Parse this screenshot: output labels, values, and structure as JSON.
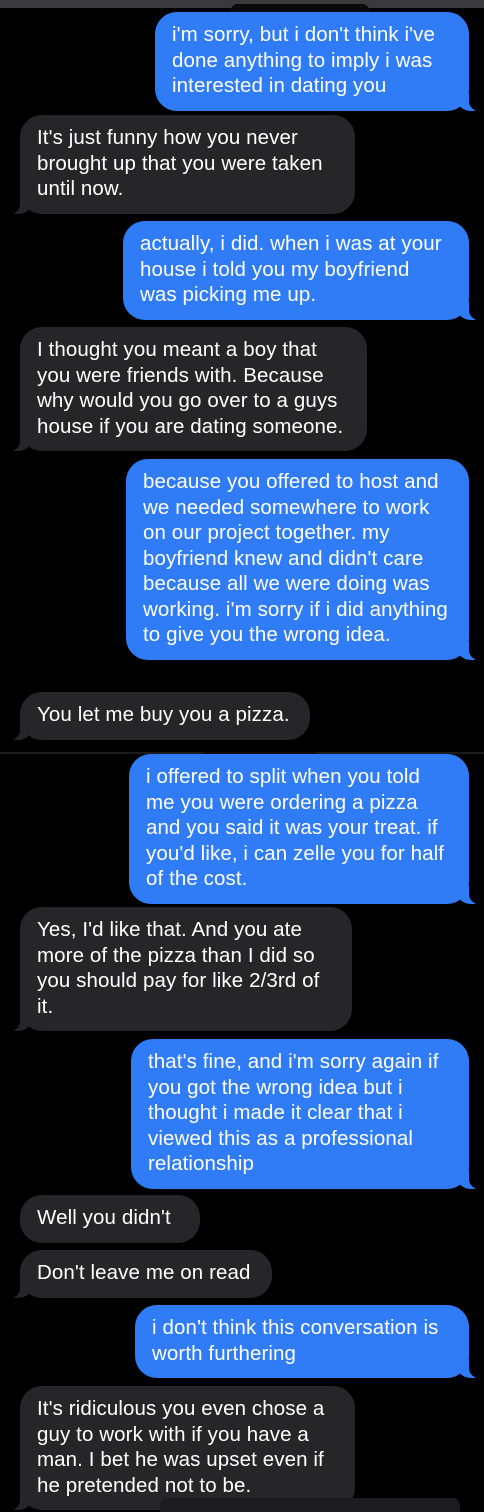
{
  "conversation": {
    "messages": [
      {
        "direction": "sent",
        "text": "i'm sorry, but i don't think i've done anything to imply i was interested in dating you"
      },
      {
        "direction": "received",
        "text": "It's just funny how you never brought up that you were taken until now."
      },
      {
        "direction": "sent",
        "text": "actually, i did. when i was at your house i told you my boyfriend was picking me up."
      },
      {
        "direction": "received",
        "text": "I thought you meant a boy that you were friends with. Because why would you go over to a guys house if you are dating someone."
      },
      {
        "direction": "sent",
        "text": "because you offered to host and we needed somewhere to work on our project together. my boyfriend knew and didn't care because all we were doing was working. i'm sorry if i did anything to give you the wrong idea."
      },
      {
        "direction": "received",
        "text": "You let me buy you a pizza."
      },
      {
        "direction": "sent",
        "text": "i offered to split when you told me you were ordering a pizza and you said it was your treat. if you'd like, i can zelle you for half of the cost."
      },
      {
        "direction": "received",
        "text": "Yes, I'd like that. And you ate more of the pizza than I did so you should pay for like 2/3rd of it."
      },
      {
        "direction": "sent",
        "text": "that's fine, and i'm sorry again if you got the wrong idea but i thought i made it clear that i viewed this as a professional relationship"
      },
      {
        "direction": "received",
        "text": "Well you didn't"
      },
      {
        "direction": "received",
        "text": "Don't leave me on read"
      },
      {
        "direction": "sent",
        "text": "i don't think this conversation is worth furthering"
      },
      {
        "direction": "received",
        "text": "It's ridiculous you even chose a guy to work with if you have a man. I bet he was upset even if he pretended not to be."
      }
    ]
  },
  "colors": {
    "background": "#000000",
    "sent_bubble": "#2f7cf6",
    "received_bubble": "#262628",
    "text": "#ffffff"
  }
}
